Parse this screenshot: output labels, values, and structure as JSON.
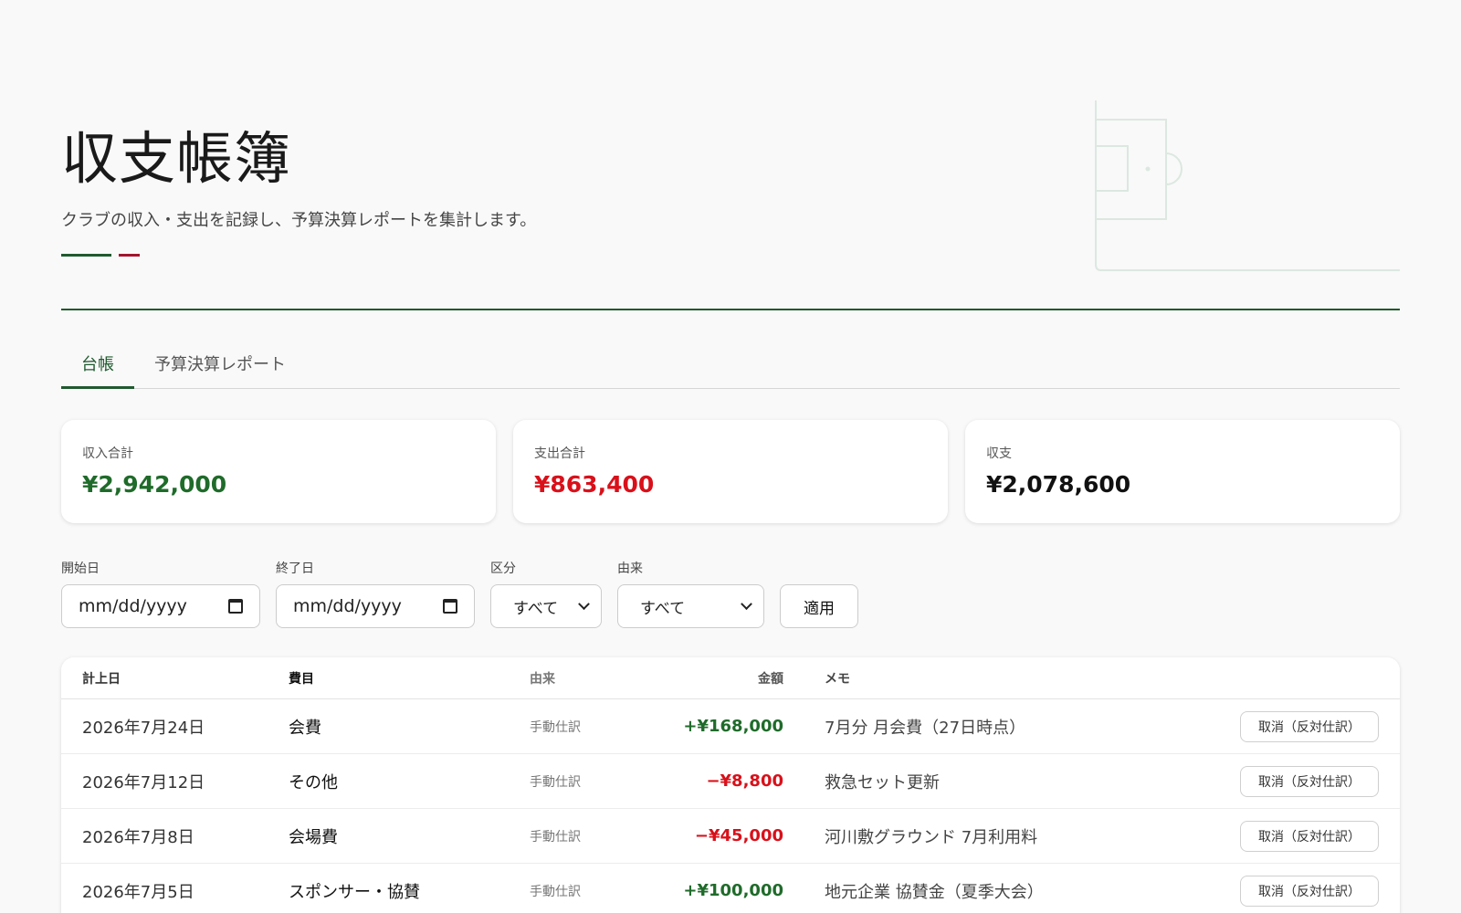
{
  "header": {
    "title": "収支帳簿",
    "subtitle": "クラブの収入・支出を記録し、予算決算レポートを集計します。",
    "accent_green": "#1f5a2e",
    "accent_red": "#a3142e"
  },
  "tabs": [
    {
      "label": "台帳",
      "active": true
    },
    {
      "label": "予算決算レポート",
      "active": false
    }
  ],
  "summary": {
    "income": {
      "label": "収入合計",
      "value": "¥2,942,000"
    },
    "expense": {
      "label": "支出合計",
      "value": "¥863,400"
    },
    "balance": {
      "label": "収支",
      "value": "¥2,078,600"
    }
  },
  "filters": {
    "start_label": "開始日",
    "start_placeholder": "mm/dd/yyyy",
    "end_label": "終了日",
    "end_placeholder": "mm/dd/yyyy",
    "type_label": "区分",
    "type_value": "すべて",
    "origin_label": "由来",
    "origin_value": "すべて",
    "apply_label": "適用"
  },
  "table": {
    "headers": {
      "date": "計上日",
      "category": "費目",
      "source": "由来",
      "amount": "金額",
      "memo": "メモ"
    },
    "rows": [
      {
        "date": "2026年7月24日",
        "category": "会費",
        "source": "手動仕訳",
        "amount": "+¥168,000",
        "sign": "pos",
        "memo": "7月分 月会費（27日時点）",
        "action": "取消（反対仕訳）"
      },
      {
        "date": "2026年7月12日",
        "category": "その他",
        "source": "手動仕訳",
        "amount": "−¥8,800",
        "sign": "neg",
        "memo": "救急セット更新",
        "action": "取消（反対仕訳）"
      },
      {
        "date": "2026年7月8日",
        "category": "会場費",
        "source": "手動仕訳",
        "amount": "−¥45,000",
        "sign": "neg",
        "memo": "河川敷グラウンド 7月利用料",
        "action": "取消（反対仕訳）"
      },
      {
        "date": "2026年7月5日",
        "category": "スポンサー・協賛",
        "source": "手動仕訳",
        "amount": "+¥100,000",
        "sign": "pos",
        "memo": "地元企業 協賛金（夏季大会）",
        "action": "取消（反対仕訳）"
      }
    ]
  },
  "colors": {
    "positive": "#1f6b2a",
    "negative": "#d9101a",
    "pitch_lines": "#dce8e0"
  },
  "icons": {
    "calendar": "calendar-icon",
    "dropdown": "chevron-down-icon",
    "decoration": "soccer-pitch-icon"
  }
}
